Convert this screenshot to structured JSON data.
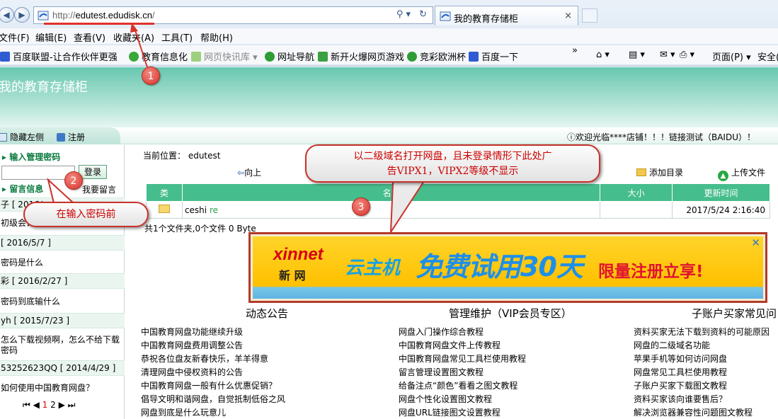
{
  "browser": {
    "url_prefix": "http://",
    "url_domain": "edutest.edudisk.cn",
    "url_suffix": "/",
    "tab_title": "我的教育存储柜",
    "tab_close": "×"
  },
  "menu": [
    "文件(F)",
    "编辑(E)",
    "查看(V)",
    "收藏夹(A)",
    "工具(T)",
    "帮助(H)"
  ],
  "favorites": [
    "百度联盟-让合作伙伴更强",
    "教育信息化",
    "网页快讯库 ▾",
    "网址导航",
    "新开火爆网页游戏",
    "竞彩欧洲杯",
    "百度一下"
  ],
  "commands": {
    "page": "页面(P) ▾",
    "safety": "安全("
  },
  "site": {
    "title": "我的教育存储柜"
  },
  "subbar": {
    "hide_left": "隐藏左侧",
    "register": "注册",
    "welcome": "欢迎光临****店铺！！！链接测试（BAIDU）！"
  },
  "sidebar": {
    "pwd_heading": "输入管理密码",
    "login": "登录",
    "msg_heading": "留言信息",
    "my_msg": "我要留言",
    "rows": [
      "子 [ 2016/",
      "初级会计",
      "[ 2016/5/7 ]",
      "密码是什么",
      "彩 [ 2016/2/27 ]",
      "密码到底输什么",
      "yh [ 2015/7/23 ]",
      "怎么下载视频啊，怎么不给下载",
      "密码",
      "53252623QQ [ 2014/4/29 ]",
      "如何使用中国教育网盘？"
    ],
    "pager_first": "⏮ ◀",
    "pager_p1": "1",
    "pager_p2": "2",
    "pager_last": "▶ ⏭"
  },
  "main": {
    "breadcrumb": "当前位置： edutest",
    "up": "向上",
    "add_folder": "添加目录",
    "upload": "上传文件",
    "columns": [
      "类",
      "名称",
      "大小",
      "更新时间"
    ],
    "file": {
      "name": "ceshi",
      "tag": "re",
      "size": "",
      "time": "2017/5/24 2:16:40"
    },
    "summary": "共1个文件夹,0个文件 0 Byte"
  },
  "ad": {
    "logo_en": "xinnet",
    "logo_cn": "新 网",
    "t1": "云主机",
    "t2": "免费试用30天",
    "t3": "限量注册立享!",
    "close": "✕"
  },
  "sections": {
    "col1_title": "动态公告",
    "col1": [
      "中国教育网盘功能继续升级",
      "中国教育网盘费用调整公告",
      "恭祝各位盘友新春快乐，羊羊得意",
      "清理网盘中侵权资料的公告",
      "中国教育网盘一般有什么优惠促销？",
      "倡导文明和谐网盘，自觉抵制低俗之风",
      "网盘到底是什么玩意儿"
    ],
    "col2_title": "管理维护（VIP会员专区）",
    "col2": [
      "网盘入门操作综合教程",
      "中国教育网盘文件上传教程",
      "中国教育网盘常见工具栏使用教程",
      "留言管理设置图文教程",
      "给备注点“颜色”看看之图文教程",
      "网盘个性化设置图文教程",
      "网盘URL链接图文设置教程"
    ],
    "col3_title": "子账户买家常见问",
    "col3": [
      "资料买家无法下载到资料的可能原因",
      "网盘的二级域名功能",
      "苹果手机等如何访问网盘",
      "网盘常见工具栏使用教程",
      "子账户买家下载图文教程",
      "资料买家该向谁要售后？",
      "解决浏览器兼容性问题图文教程"
    ]
  },
  "annotations": {
    "b1": "1",
    "b2": "2",
    "b3": "3",
    "callout2": "在输入密码前",
    "callout3_l1": "以二级域名打开网盘，且未登录情形下此处广",
    "callout3_l2": "告VIPX1，VIPX2等级不显示"
  }
}
